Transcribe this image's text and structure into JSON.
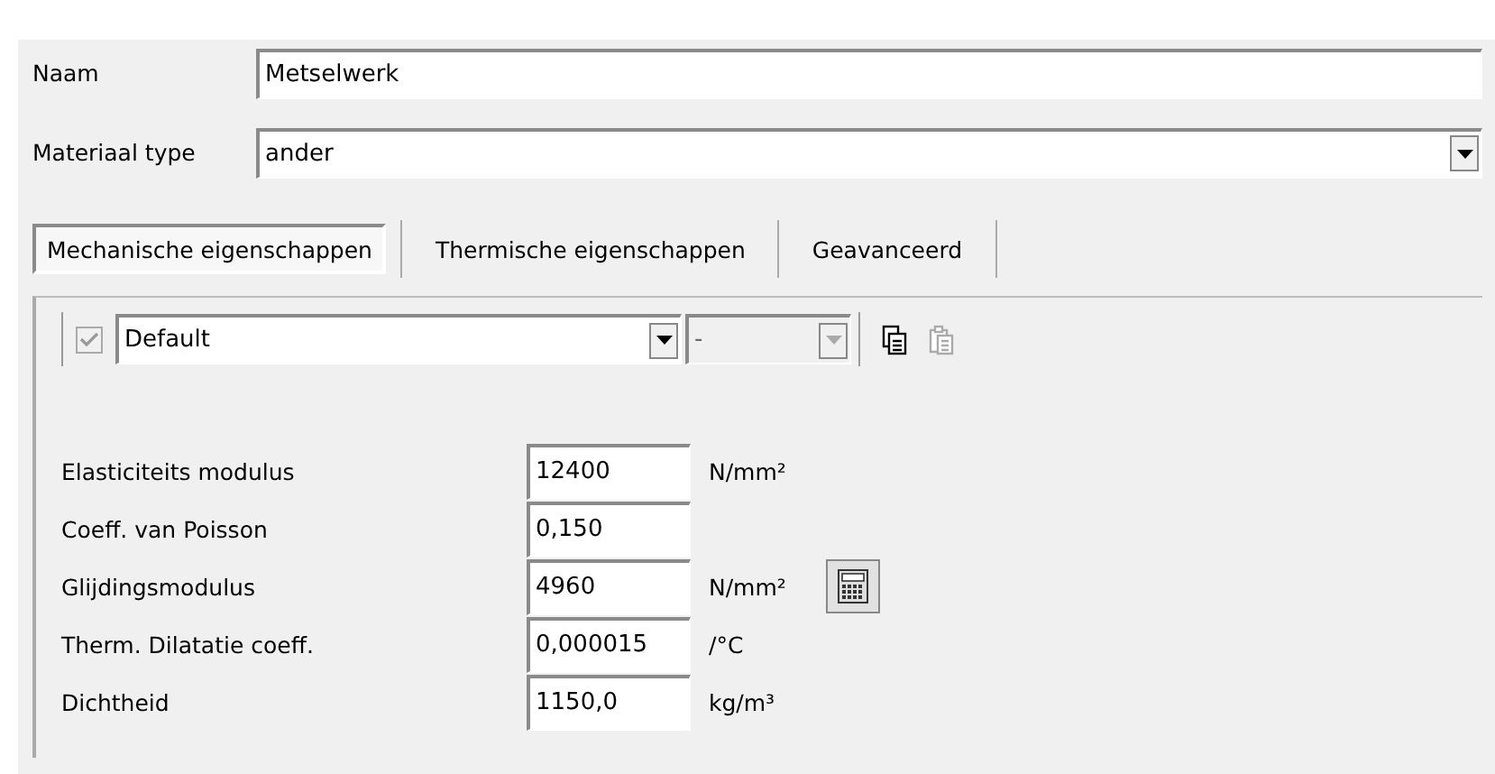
{
  "name_field": {
    "label": "Naam",
    "value": "Metselwerk"
  },
  "material_type": {
    "label": "Materiaal type",
    "value": "ander"
  },
  "tabs": [
    {
      "label": "Mechanische eigenschappen",
      "selected": true
    },
    {
      "label": "Thermische eigenschappen",
      "selected": false
    },
    {
      "label": "Geavanceerd",
      "selected": false
    }
  ],
  "toolbar": {
    "checkbox": {
      "checked": true,
      "disabled": true
    },
    "profile": {
      "value": "Default",
      "disabled": false
    },
    "variant": {
      "value": "-",
      "disabled": true
    },
    "copy": {
      "disabled": false
    },
    "paste": {
      "disabled": true
    }
  },
  "properties": [
    {
      "label": "Elasticiteits modulus",
      "value": "12400",
      "unit": "N/mm²",
      "calculator": false
    },
    {
      "label": "Coeff. van Poisson",
      "value": "0,150",
      "calculator": false
    },
    {
      "label": "Glijdingsmodulus",
      "value": "4960",
      "unit": "N/mm²",
      "calculator": true
    },
    {
      "label": "Therm. Dilatatie coeff.",
      "value": "0,000015",
      "unit": "/°C",
      "calculator": false
    },
    {
      "label": "Dichtheid",
      "value": "1150,0",
      "unit": "kg/m³",
      "calculator": false
    }
  ]
}
